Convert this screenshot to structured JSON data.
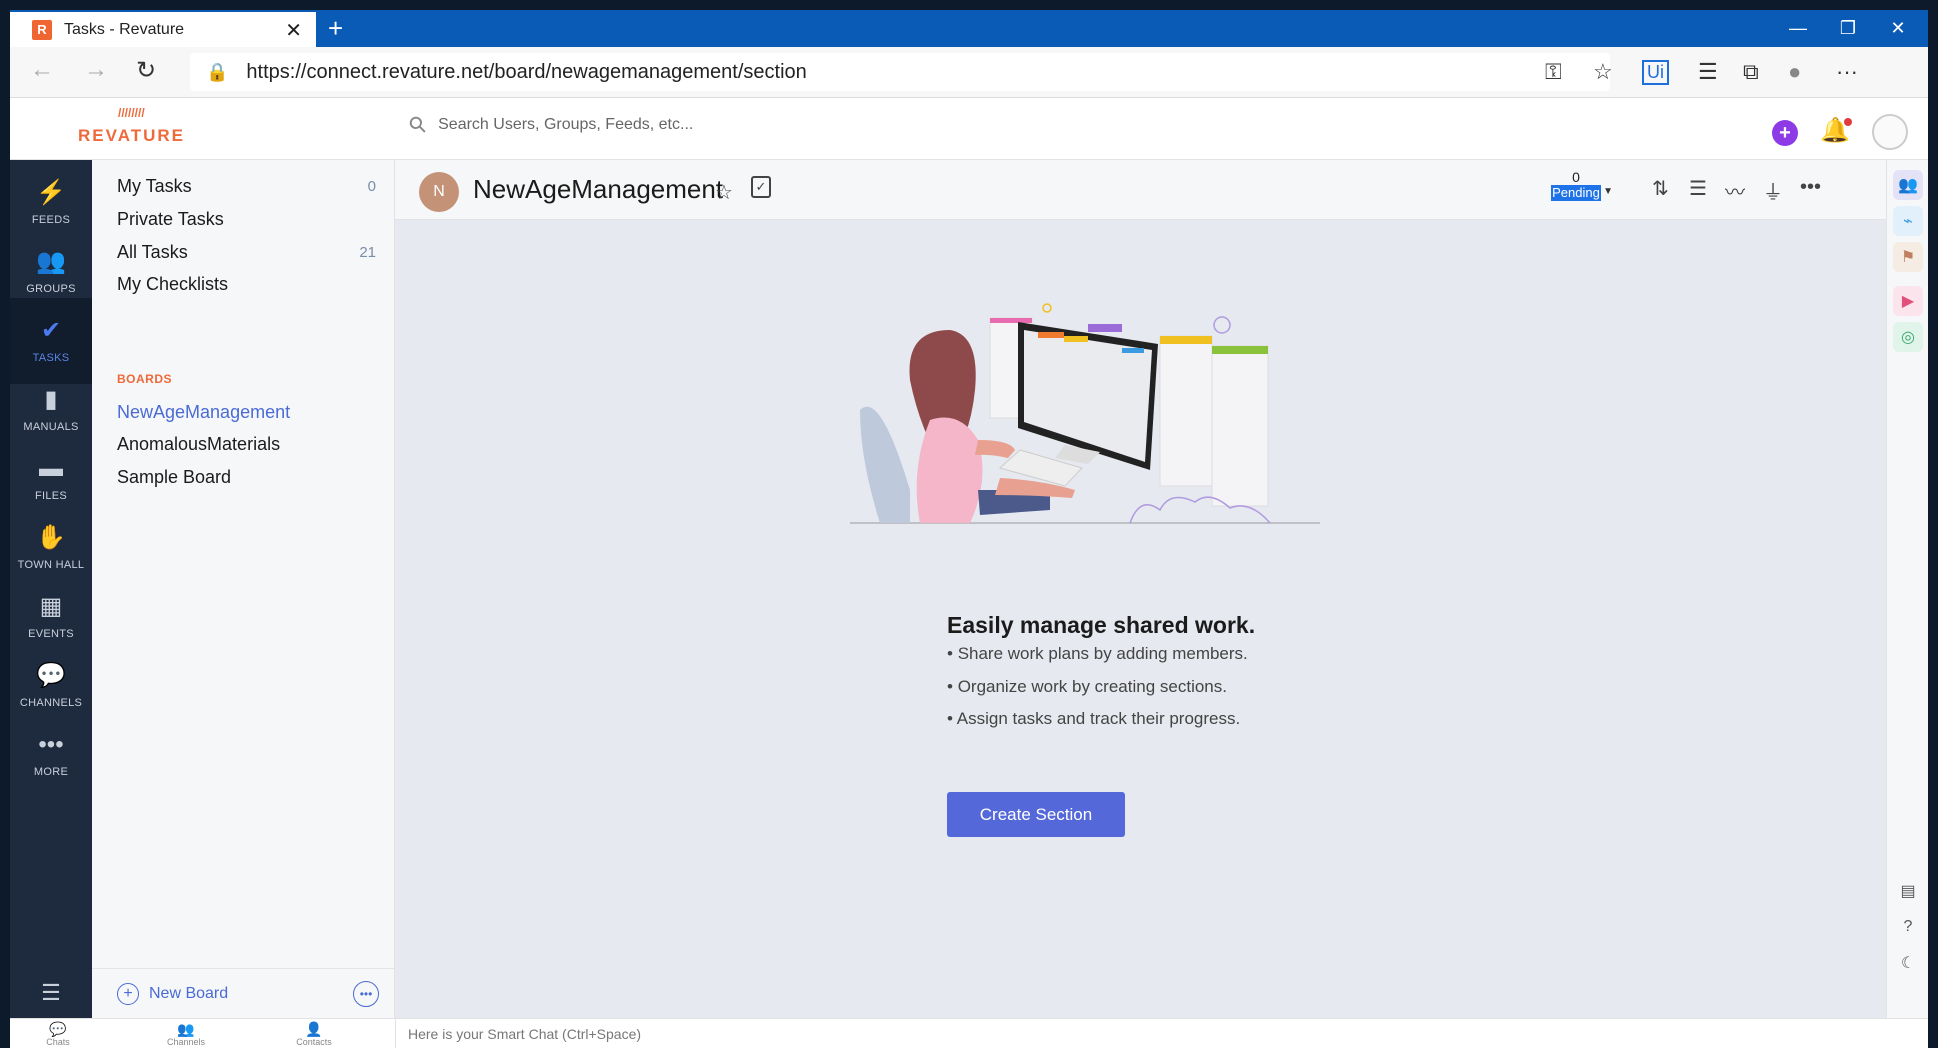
{
  "browser": {
    "tab_title": "Tasks - Revature",
    "tab_favicon": "R",
    "url": "https://connect.revature.net/board/newagemanagement/section"
  },
  "app": {
    "logo": "REVATURE",
    "search_placeholder": "Search Users, Groups, Feeds, etc...",
    "accent_color": "#5468d9",
    "brand_color": "#ee6a3a"
  },
  "leftnav": [
    {
      "label": "FEEDS",
      "icon": "bolt-icon"
    },
    {
      "label": "GROUPS",
      "icon": "groups-icon"
    },
    {
      "label": "TASKS",
      "icon": "check-circle-icon"
    },
    {
      "label": "MANUALS",
      "icon": "book-icon"
    },
    {
      "label": "FILES",
      "icon": "folder-icon"
    },
    {
      "label": "TOWN HALL",
      "icon": "hand-icon"
    },
    {
      "label": "EVENTS",
      "icon": "calendar-icon"
    },
    {
      "label": "CHANNELS",
      "icon": "chat-icon"
    },
    {
      "label": "MORE",
      "icon": "more-icon"
    }
  ],
  "sidepanel": {
    "items": [
      {
        "label": "My Tasks",
        "count": "0"
      },
      {
        "label": "Private Tasks",
        "count": ""
      },
      {
        "label": "All Tasks",
        "count": "21"
      },
      {
        "label": "My Checklists",
        "count": ""
      }
    ],
    "boards_header": "BOARDS",
    "boards": [
      "NewAgeManagement",
      "AnomalousMaterials",
      "Sample Board"
    ],
    "new_board": "New Board"
  },
  "board": {
    "avatar_letter": "N",
    "title": "NewAgeManagement",
    "pending_count": "0",
    "pending_label": "Pending"
  },
  "empty_state": {
    "heading": "Easily manage shared work.",
    "bullets": [
      "Share work plans by adding members.",
      "Organize work by creating sections.",
      "Assign tasks and track their progress."
    ],
    "button": "Create Section"
  },
  "footer": {
    "chats": "Chats",
    "channels": "Channels",
    "contacts": "Contacts",
    "smart_chat_placeholder": "Here is your Smart Chat (Ctrl+Space)"
  }
}
